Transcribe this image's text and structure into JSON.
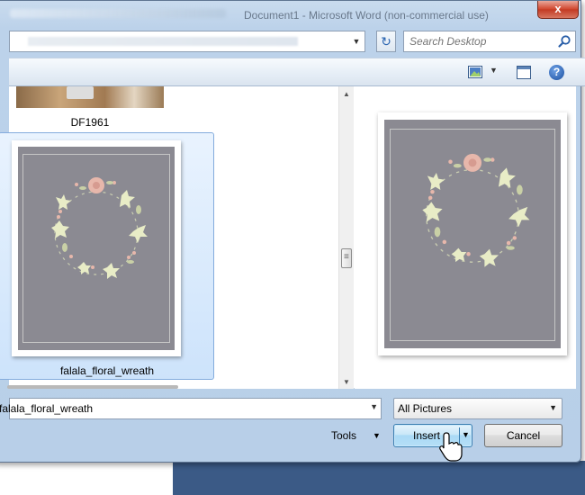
{
  "window": {
    "title": "Document1 - Microsoft Word (non-commercial use)",
    "close_label": "x"
  },
  "search": {
    "placeholder": "Search Desktop"
  },
  "toolbar": {
    "refresh_glyph": "↻",
    "help_glyph": "?"
  },
  "files": [
    {
      "name": "DF1961",
      "selected": false
    },
    {
      "name": "falala_floral_wreath",
      "selected": true
    }
  ],
  "footer": {
    "file_name_value": "falala_floral_wreath",
    "file_type_filter": "All Pictures",
    "tools_label": "Tools",
    "insert_label": "Insert",
    "cancel_label": "Cancel"
  },
  "colors": {
    "art_background": "#8b8a92",
    "rose": "#e7b7ab",
    "leaf": "#e8ecc6",
    "selection": "#cde3fb"
  },
  "icons": {
    "search": "search-icon",
    "refresh": "refresh-icon",
    "views": "change-view-icon",
    "preview_pane": "preview-pane-icon",
    "help": "help-icon",
    "close": "close-icon"
  }
}
